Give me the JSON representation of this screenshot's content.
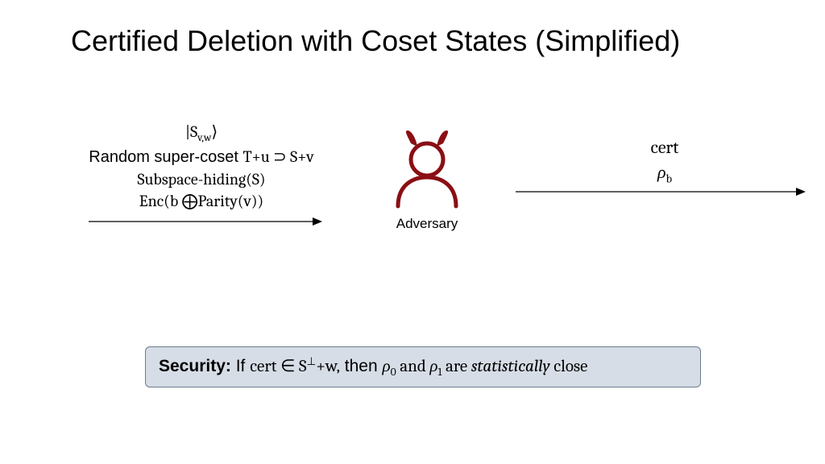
{
  "title": "Certified Deletion with Coset States (Simplified)",
  "left_labels": {
    "line1_prefix": "|S",
    "line1_sub": "v,w",
    "line1_suffix": "⟩",
    "line2_prefix": "Random super-coset ",
    "line2_math": "T+u ⊃ S+v",
    "line3": "Subspace-hiding(S)",
    "line4": "Enc(b ⨁Parity(v))"
  },
  "adversary_label": "Adversary",
  "right_labels": {
    "cert": "cert",
    "rho_prefix": "ρ",
    "rho_sub": "b"
  },
  "security": {
    "label": "Security:",
    "text1": " If ",
    "cert": "cert",
    "in": " ∈ S",
    "perp": "⊥",
    "plusw": "+w,",
    "then": " then ",
    "rho": "ρ",
    "zero": "0",
    "and_": " and ",
    "one": "1",
    "rest": " are ",
    "stat": "statistically",
    "close": " close"
  }
}
